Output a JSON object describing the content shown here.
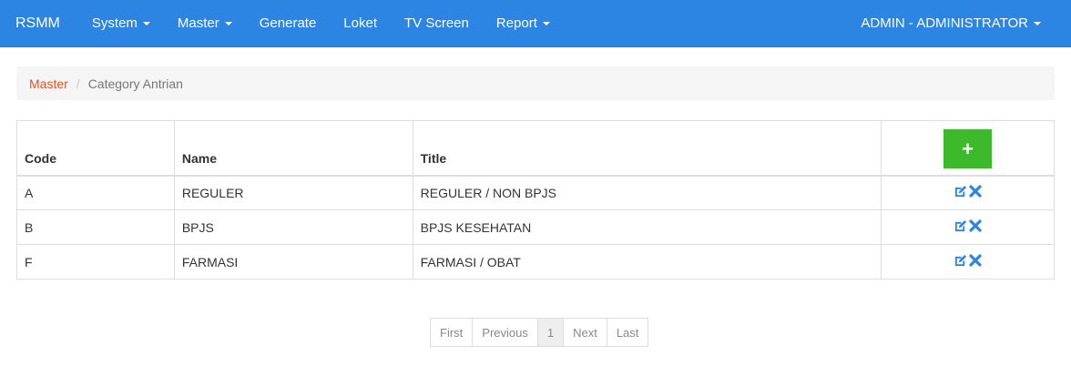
{
  "navbar": {
    "brand": "RSMM",
    "items": [
      {
        "label": "System",
        "dropdown": true
      },
      {
        "label": "Master",
        "dropdown": true
      },
      {
        "label": "Generate",
        "dropdown": false
      },
      {
        "label": "Loket",
        "dropdown": false
      },
      {
        "label": "TV Screen",
        "dropdown": false
      },
      {
        "label": "Report",
        "dropdown": true
      }
    ],
    "user": "ADMIN - ADMINISTRATOR"
  },
  "breadcrumb": {
    "link": "Master",
    "separator": "/",
    "active": "Category Antrian"
  },
  "table": {
    "headers": {
      "code": "Code",
      "name": "Name",
      "title": "Title"
    },
    "add_label": "+",
    "rows": [
      {
        "code": "A",
        "name": "REGULER",
        "title": "REGULER / NON BPJS"
      },
      {
        "code": "B",
        "name": "BPJS",
        "title": "BPJS KESEHATAN"
      },
      {
        "code": "F",
        "name": "FARMASI",
        "title": "FARMASI / OBAT"
      }
    ]
  },
  "pagination": {
    "first": "First",
    "previous": "Previous",
    "current": "1",
    "next": "Next",
    "last": "Last"
  },
  "colors": {
    "navbar": "#2c84e3",
    "link": "#e8501e",
    "add_button": "#3cba2b",
    "action_icon": "#2c84e3"
  }
}
